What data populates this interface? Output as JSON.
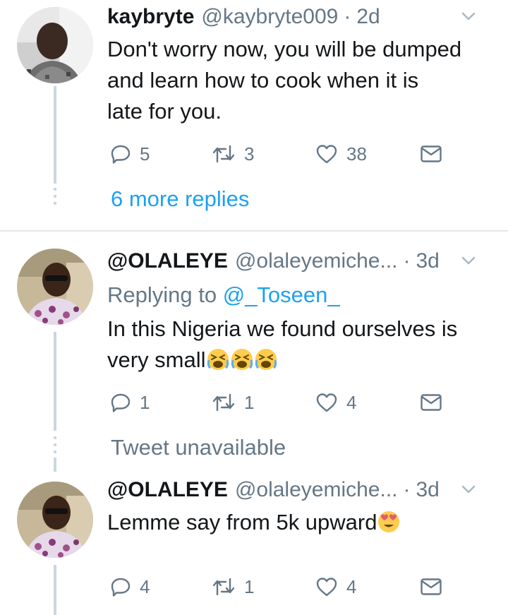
{
  "tweets": [
    {
      "name": "kaybryte",
      "handle": "@kaybryte009",
      "time": "2d",
      "text_lines": [
        "Don't worry now, you will be dumped",
        "and learn how to cook when it is",
        "late for you."
      ],
      "replies": "5",
      "retweets": "3",
      "likes": "38"
    },
    {
      "name": "@OLALEYE",
      "handle": "@olaleyemiche...",
      "time": "3d",
      "replying_prefix": "Replying to ",
      "replying_to": "@_Toseen_",
      "text_line1": "In this Nigeria we found ourselves is",
      "text_line2": "very small",
      "emoji": "tired-face-emoji x3",
      "replies": "1",
      "retweets": "1",
      "likes": "4"
    },
    {
      "name": "@OLALEYE",
      "handle": "@olaleyemiche...",
      "time": "3d",
      "text": "Lemme say from 5k upward",
      "emoji": "heart-eyes-emoji",
      "replies": "4",
      "retweets": "1",
      "likes": "4"
    }
  ],
  "more_replies": "6 more replies",
  "tweet_unavailable": "Tweet unavailable",
  "separator": "·",
  "colors": {
    "link_blue": "#1da1f2",
    "gray_text": "#657786",
    "dark_text": "#14171a",
    "thread_line": "#ccd6dd",
    "divider": "#e1e8ed"
  },
  "icons": [
    "reply-icon",
    "retweet-icon",
    "like-icon",
    "dm-icon",
    "chevron-down-icon"
  ]
}
